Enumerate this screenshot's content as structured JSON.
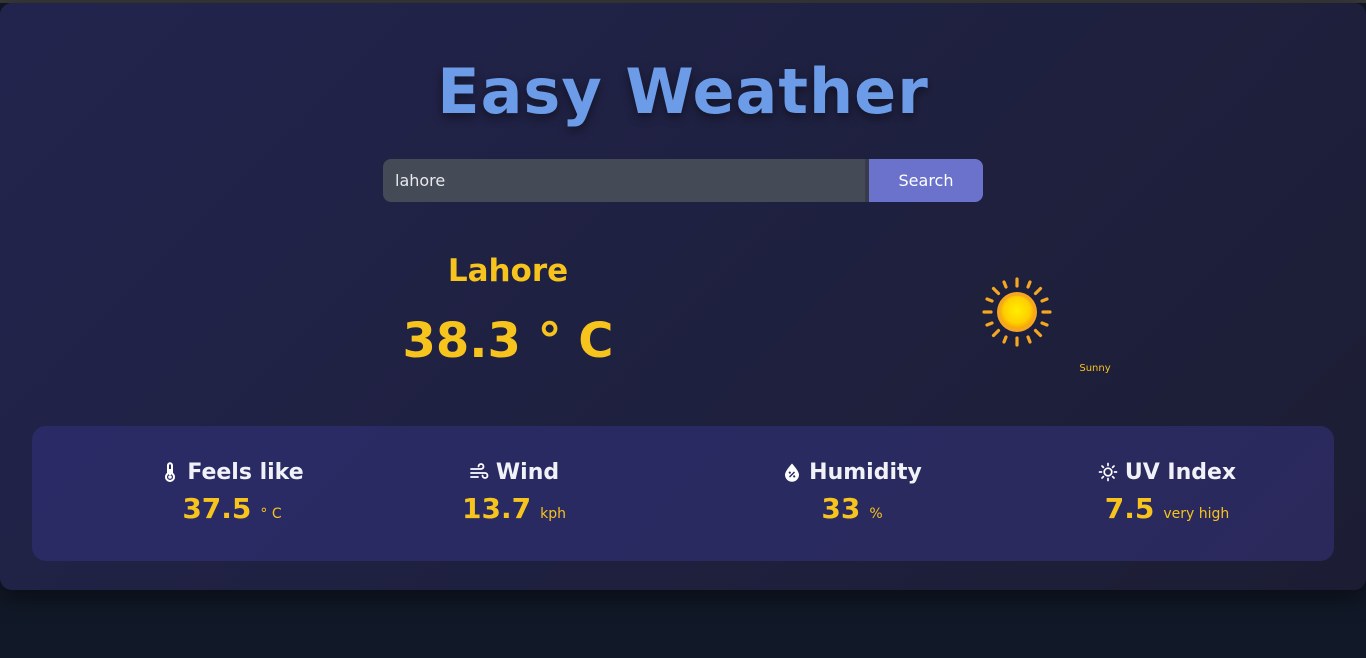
{
  "app": {
    "title": "Easy Weather"
  },
  "search": {
    "value": "lahore",
    "button_label": "Search"
  },
  "current": {
    "city": "Lahore",
    "temperature": "38.3 ° C",
    "condition": "Sunny",
    "condition_icon": "sun-icon"
  },
  "stats": [
    {
      "label": "Feels like",
      "value": "37.5",
      "unit": "° C",
      "icon": "thermometer-icon"
    },
    {
      "label": "Wind",
      "value": "13.7",
      "unit": "kph",
      "icon": "wind-icon"
    },
    {
      "label": "Humidity",
      "value": "33",
      "unit": "%",
      "icon": "humidity-drop-icon"
    },
    {
      "label": "UV Index",
      "value": "7.5",
      "unit": "very high",
      "icon": "uv-sun-icon"
    }
  ],
  "colors": {
    "title": "#6c9be8",
    "accent": "#f7c31d",
    "button": "#6a72cc",
    "background": "#111827",
    "card": "#1f2142",
    "stats_panel": "#2a2b66"
  }
}
